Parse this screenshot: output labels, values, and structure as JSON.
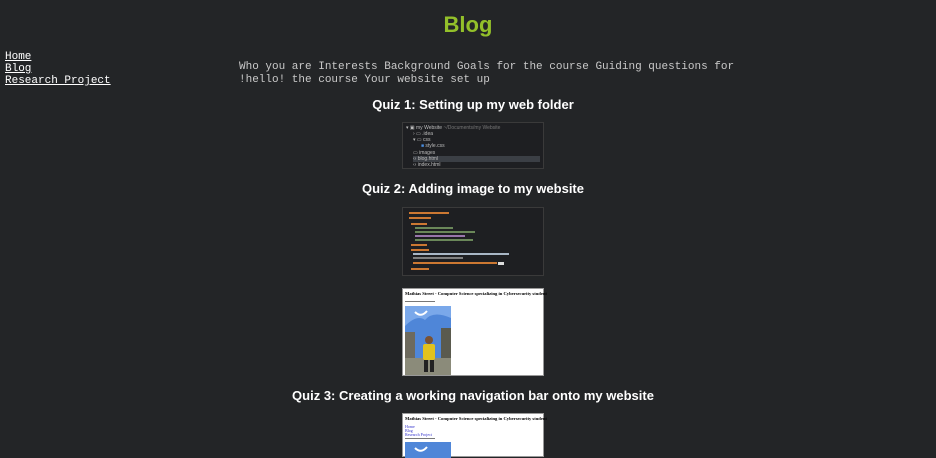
{
  "header": {
    "title": "Blog"
  },
  "nav": {
    "items": [
      "Home",
      "Blog",
      "Research Project"
    ]
  },
  "intro": {
    "text": "Who you are Interests Background Goals for the course Guiding questions for !hello! the course Your website set up"
  },
  "quizzes": [
    {
      "title": "Quiz 1: Setting up my web folder"
    },
    {
      "title": "Quiz 2: Adding image to my website"
    },
    {
      "title": "Quiz 3: Creating a working navigation bar onto my website"
    }
  ],
  "explorer": {
    "root": "my Website",
    "items": [
      ".idea",
      "css",
      "style.css",
      "images",
      "blog.html",
      "index.html"
    ]
  },
  "preview": {
    "heading": "Mathias Street - Computer Science specializing in Cybersecurity student",
    "nav_links": [
      "Home",
      "Blog",
      "Research Project"
    ]
  },
  "colors": {
    "accent": "#93c02a",
    "background": "#232527"
  }
}
